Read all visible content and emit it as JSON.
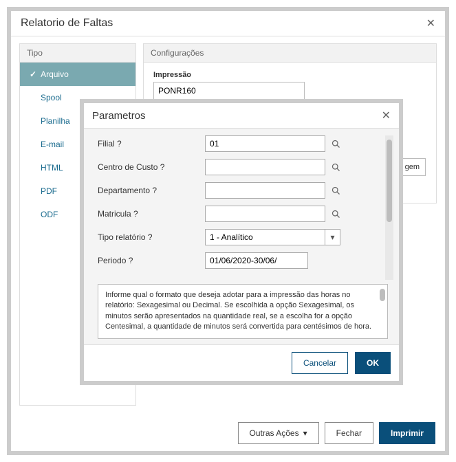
{
  "main": {
    "title": "Relatorio de Faltas",
    "tipo_label": "Tipo",
    "config_label": "Configurações",
    "impressao_label": "Impressão",
    "impressao_value": "PONR160",
    "right_stub": "gem",
    "tipo_items": [
      "Arquivo",
      "Spool",
      "Planilha",
      "E-mail",
      "HTML",
      "PDF",
      "ODF"
    ]
  },
  "footer": {
    "outras_label": "Outras Ações",
    "fechar_label": "Fechar",
    "imprimir_label": "Imprimir"
  },
  "params": {
    "title": "Parametros",
    "rows": {
      "filial": {
        "label": "Filial ?",
        "value": "01"
      },
      "cc": {
        "label": "Centro de Custo ?",
        "value": ""
      },
      "depto": {
        "label": "Departamento ?",
        "value": ""
      },
      "mat": {
        "label": "Matricula ?",
        "value": ""
      },
      "tipo": {
        "label": "Tipo relatório ?",
        "value": "1 - Analítico"
      },
      "periodo": {
        "label": "Periodo ?",
        "value": "01/06/2020-30/06/"
      }
    },
    "info_text": "Informe qual o formato que deseja adotar para a impressão das horas no relatório: Sexagesimal ou Decimal.\nSe escolhida a opção Sexagesimal, os minutos serão apresentados na quantidade real, se a escolha for a opção Centesimal, a quantidade de minutos será convertida para centésimos de hora.",
    "cancel_label": "Cancelar",
    "ok_label": "OK"
  }
}
